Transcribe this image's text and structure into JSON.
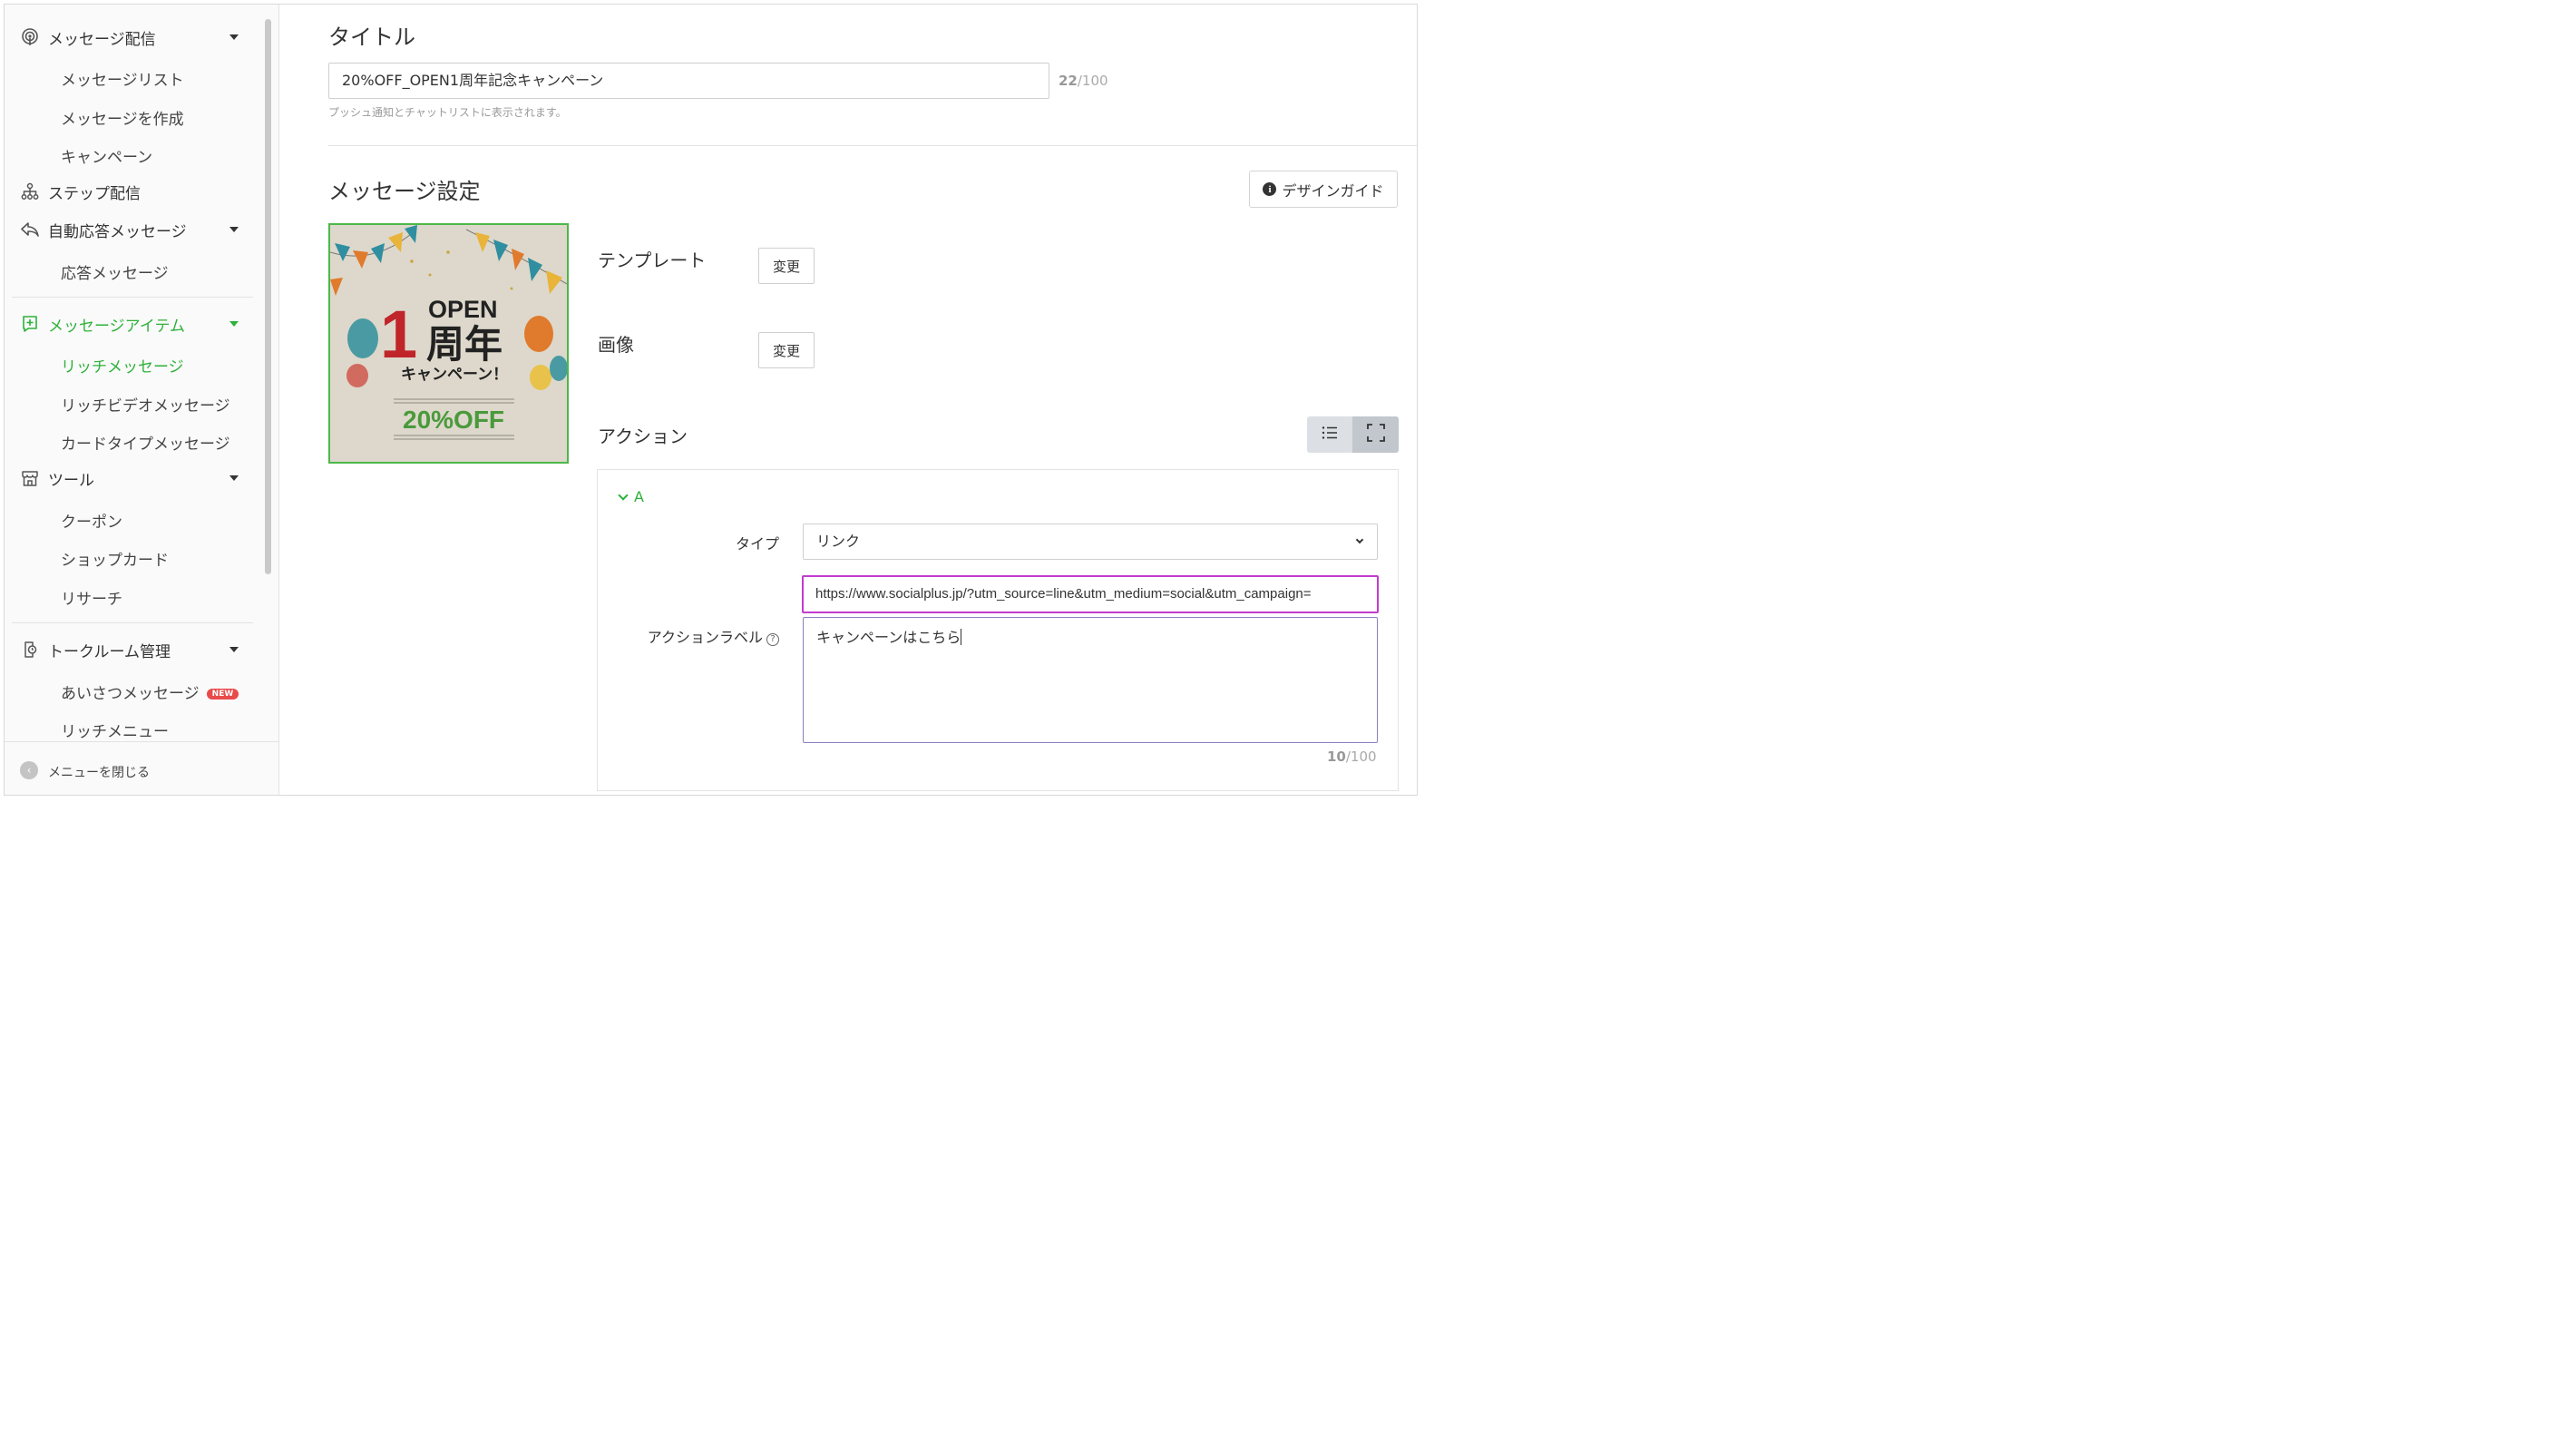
{
  "sidebar": {
    "items": [
      {
        "label": "メッセージ配信",
        "icon": "broadcast-icon",
        "expandable": true
      },
      {
        "label": "メッセージリスト"
      },
      {
        "label": "メッセージを作成"
      },
      {
        "label": "キャンペーン"
      },
      {
        "label": "ステップ配信",
        "icon": "step-tree-icon"
      },
      {
        "label": "自動応答メッセージ",
        "icon": "reply-icon",
        "expandable": true
      },
      {
        "label": "応答メッセージ"
      },
      {
        "label": "メッセージアイテム",
        "icon": "add-square-icon",
        "expandable": true,
        "active": true
      },
      {
        "label": "リッチメッセージ",
        "active": true
      },
      {
        "label": "リッチビデオメッセージ"
      },
      {
        "label": "カードタイプメッセージ"
      },
      {
        "label": "ツール",
        "icon": "store-icon",
        "expandable": true
      },
      {
        "label": "クーポン"
      },
      {
        "label": "ショップカード"
      },
      {
        "label": "リサーチ"
      },
      {
        "label": "トークルーム管理",
        "icon": "chat-room-icon",
        "expandable": true
      },
      {
        "label": "あいさつメッセージ",
        "badge": "NEW"
      },
      {
        "label": "リッチメニュー"
      }
    ],
    "close_label": "メニューを閉じる"
  },
  "title_section": {
    "heading": "タイトル",
    "value": "20%OFF_OPEN1周年記念キャンペーン",
    "count": "22",
    "max": "/100",
    "hint": "プッシュ通知とチャットリストに表示されます。"
  },
  "message_settings": {
    "heading": "メッセージ設定",
    "design_guide_label": "デザインガイド",
    "template_label": "テンプレート",
    "template_button": "変更",
    "image_label": "画像",
    "image_button": "変更",
    "action_label": "アクション",
    "thumbnail": {
      "open": "OPEN",
      "one": "1",
      "anniv": "周年",
      "campaign": "キャンペーン！",
      "off": "20%OFF"
    }
  },
  "action_panel": {
    "section": "A",
    "type_label": "タイプ",
    "type_value": "リンク",
    "url_value": "https://www.socialplus.jp/?utm_source=line&utm_medium=social&utm_campaign=",
    "action_label_label": "アクションラベル",
    "action_label_value": "キャンペーンはこちら",
    "count": "10",
    "max": "/100"
  },
  "colors": {
    "accent": "#2eb13a",
    "url_focus_border": "#c33bd0",
    "badge": "#e94a4a"
  }
}
